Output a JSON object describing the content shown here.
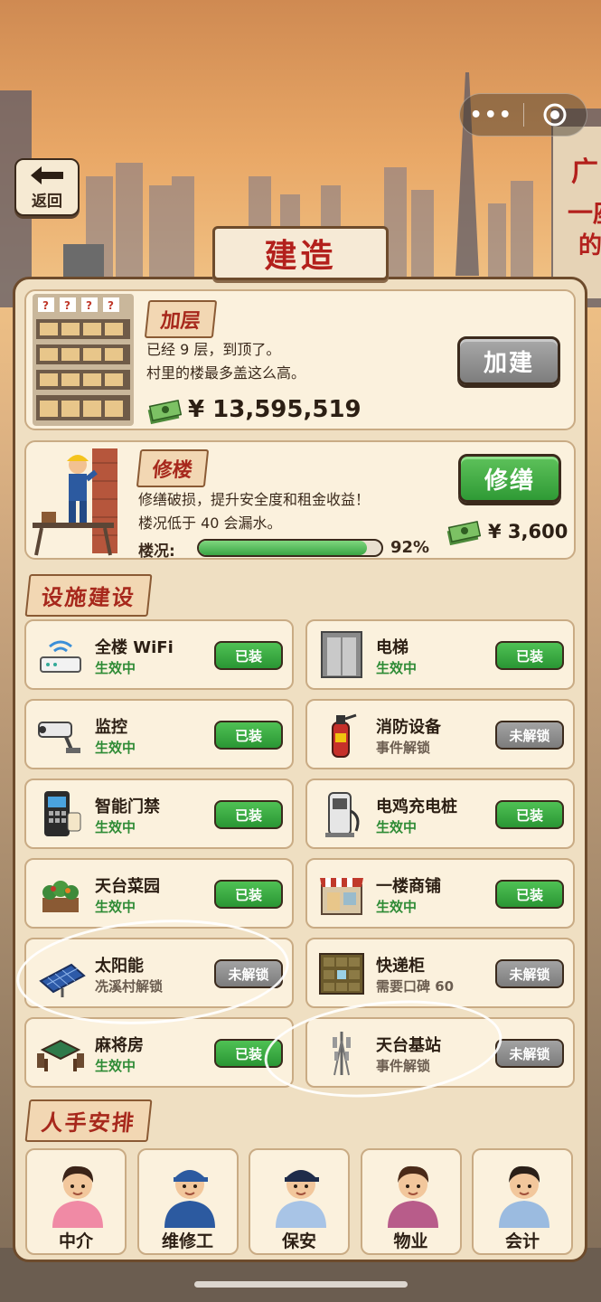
{
  "header": {
    "back_label": "返回",
    "title": "建造",
    "menu_dots": "•••"
  },
  "add_floor": {
    "tag": "加层",
    "line1": "已经 9 层，到顶了。",
    "line2": "村里的楼最多盖这么高。",
    "cost": "¥ 13,595,519",
    "button": "加建",
    "button_state": "disabled"
  },
  "repair": {
    "tag": "修楼",
    "line1": "修缮破损，提升安全度和租金收益！",
    "line2": "楼况低于 40 会漏水。",
    "cost": "¥ 3,600",
    "button": "修缮",
    "condition_label": "楼况:",
    "condition_value": "92%",
    "condition_fraction": 0.92
  },
  "facilities": {
    "section": "设施建设",
    "items": [
      {
        "name": "全楼 WiFi",
        "status": "生效中",
        "button": "已装",
        "state": "on",
        "icon": "wifi-router-icon"
      },
      {
        "name": "电梯",
        "status": "生效中",
        "button": "已装",
        "state": "on",
        "icon": "elevator-icon"
      },
      {
        "name": "监控",
        "status": "生效中",
        "button": "已装",
        "state": "on",
        "icon": "cctv-camera-icon"
      },
      {
        "name": "消防设备",
        "status": "事件解锁",
        "button": "未解锁",
        "state": "off",
        "icon": "fire-extinguisher-icon"
      },
      {
        "name": "智能门禁",
        "status": "生效中",
        "button": "已装",
        "state": "on",
        "icon": "access-control-icon"
      },
      {
        "name": "电鸡充电桩",
        "status": "生效中",
        "button": "已装",
        "state": "on",
        "icon": "charging-pile-icon"
      },
      {
        "name": "天台菜园",
        "status": "生效中",
        "button": "已装",
        "state": "on",
        "icon": "rooftop-garden-icon"
      },
      {
        "name": "一楼商铺",
        "status": "生效中",
        "button": "已装",
        "state": "on",
        "icon": "shop-icon"
      },
      {
        "name": "太阳能",
        "status": "冼溪村解锁",
        "button": "未解锁",
        "state": "off",
        "icon": "solar-panel-icon"
      },
      {
        "name": "快递柜",
        "status": "需要口碑 60",
        "button": "未解锁",
        "state": "off",
        "icon": "parcel-locker-icon"
      },
      {
        "name": "麻将房",
        "status": "生效中",
        "button": "已装",
        "state": "on",
        "icon": "mahjong-table-icon"
      },
      {
        "name": "天台基站",
        "status": "事件解锁",
        "button": "未解锁",
        "state": "off",
        "icon": "cell-tower-icon"
      }
    ]
  },
  "staff": {
    "section": "人手安排",
    "items": [
      {
        "name": "中介",
        "icon": "agent-avatar-icon"
      },
      {
        "name": "维修工",
        "icon": "repairman-avatar-icon"
      },
      {
        "name": "保安",
        "icon": "security-guard-avatar-icon"
      },
      {
        "name": "物业",
        "icon": "property-manager-avatar-icon"
      },
      {
        "name": "会计",
        "icon": "accountant-avatar-icon"
      }
    ]
  },
  "colors": {
    "accent_red": "#a7281c",
    "installed_green": "#3aaa3f",
    "locked_gray": "#8c8c8c",
    "panel_bg": "#efdfc2"
  }
}
